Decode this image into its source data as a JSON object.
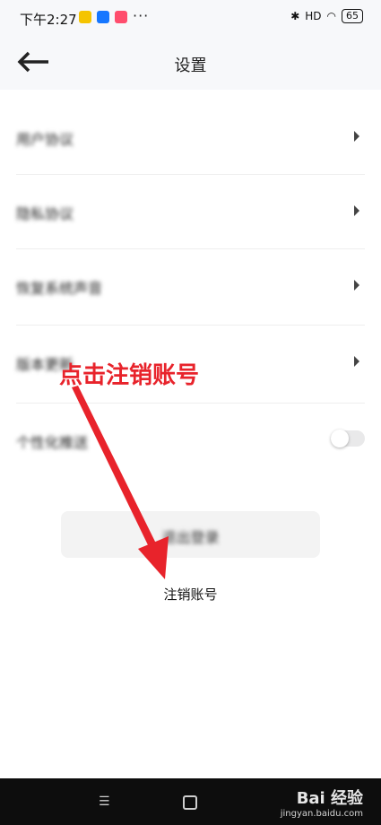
{
  "status": {
    "time": "下午2:27",
    "dots": "···",
    "battery": "65",
    "signal": "HD"
  },
  "header": {
    "title": "设置"
  },
  "list": {
    "items": [
      {
        "label": "用户协议"
      },
      {
        "label": "隐私协议"
      },
      {
        "label": "恢复系统声音"
      },
      {
        "label": "版本更新"
      },
      {
        "label": "个性化推送"
      }
    ]
  },
  "actions": {
    "logout": "退出登录",
    "cancel_account": "注销账号"
  },
  "annotation": {
    "text": "点击注销账号",
    "color": "#e8232b"
  },
  "navbar": {
    "menu_glyph": "☰"
  },
  "watermark": {
    "brand": "Bai 经验",
    "site": "jingyan.baidu.com"
  }
}
